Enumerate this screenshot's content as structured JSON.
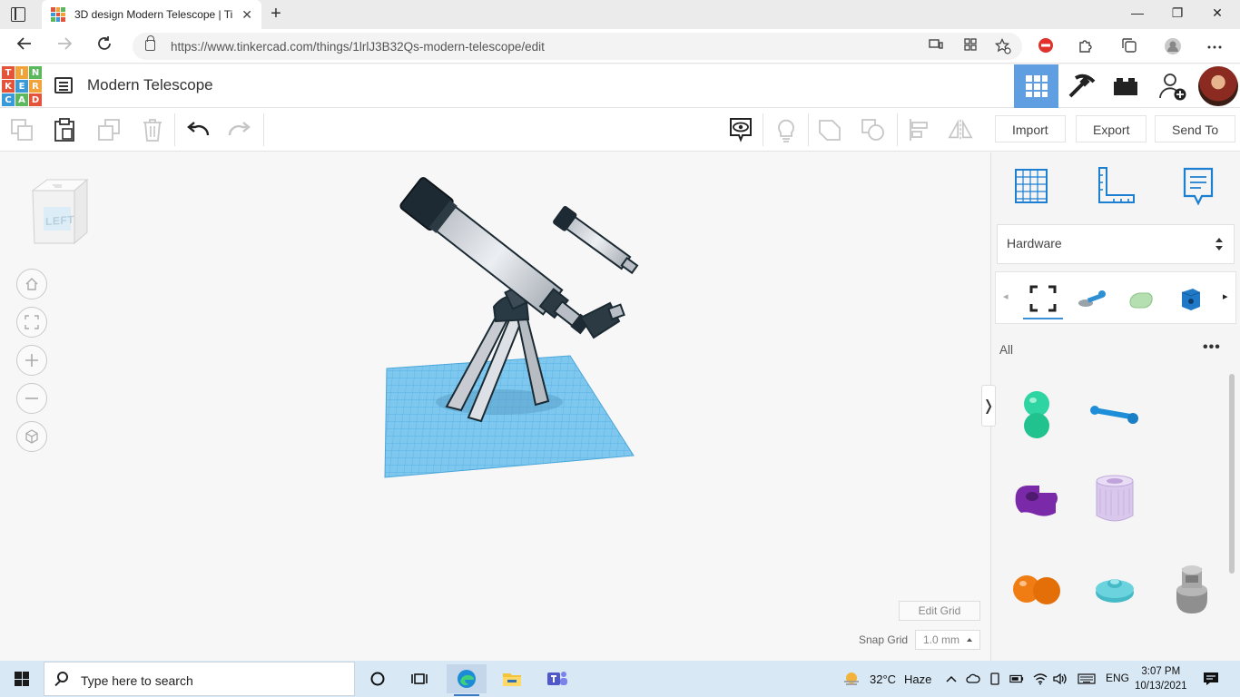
{
  "browser": {
    "tab_title": "3D design Modern Telescope | Ti",
    "tab_close": "✕",
    "new_tab": "+",
    "url": "https://www.tinkercad.com/things/1lrlJ3B32Qs-modern-telescope/edit",
    "window_controls": {
      "minimize": "—",
      "maximize": "❐",
      "close": "✕"
    }
  },
  "tinkercad": {
    "logo_letters": [
      "T",
      "I",
      "N",
      "K",
      "E",
      "R",
      "C",
      "A",
      "D"
    ],
    "logo_colors": [
      "#e4543b",
      "#f1a33a",
      "#5cb85c",
      "#e4543b",
      "#3a9ad9",
      "#f1a33a",
      "#3a9ad9",
      "#5cb85c",
      "#e4543b"
    ],
    "design_title": "Modern Telescope",
    "header_buttons": [
      "3D Design",
      "Tinker",
      "Bricks",
      "Invite"
    ],
    "toolbar": {
      "import_label": "Import",
      "export_label": "Export",
      "sendto_label": "Send To"
    },
    "viewcube_label": "LEFT",
    "edit_grid_label": "Edit Grid",
    "snap_grid_label": "Snap Grid",
    "snap_grid_value": "1.0 mm",
    "collapse_glyph": "❭"
  },
  "panel": {
    "library_selected": "Hardware",
    "filter_label": "All",
    "more_label": "•••",
    "strip_prev": "◂",
    "strip_next": "▸",
    "shapes": [
      {
        "name": "green-double-sphere",
        "color": "#2fd4a3"
      },
      {
        "name": "blue-axle",
        "color": "#1f8ed8"
      },
      {
        "name": "purple-bracket",
        "color": "#7a2aa8"
      },
      {
        "name": "lavender-spool",
        "color": "#d9c7ec"
      },
      {
        "name": "orange-double-sphere",
        "color": "#f07d13"
      },
      {
        "name": "teal-knob",
        "color": "#56cbd6"
      },
      {
        "name": "gray-valve",
        "color": "#9a9a9a"
      }
    ]
  },
  "taskbar": {
    "search_placeholder": "Type here to search",
    "weather_temp": "32°C",
    "weather_desc": "Haze",
    "language": "ENG",
    "time": "3:07 PM",
    "date": "10/13/2021",
    "notification_count": "1"
  },
  "colors": {
    "accent": "#5f9ee0",
    "workplane_blue": "#76c2ec",
    "telescope_body": "#d6d9de",
    "telescope_dark": "#1b2a33"
  }
}
